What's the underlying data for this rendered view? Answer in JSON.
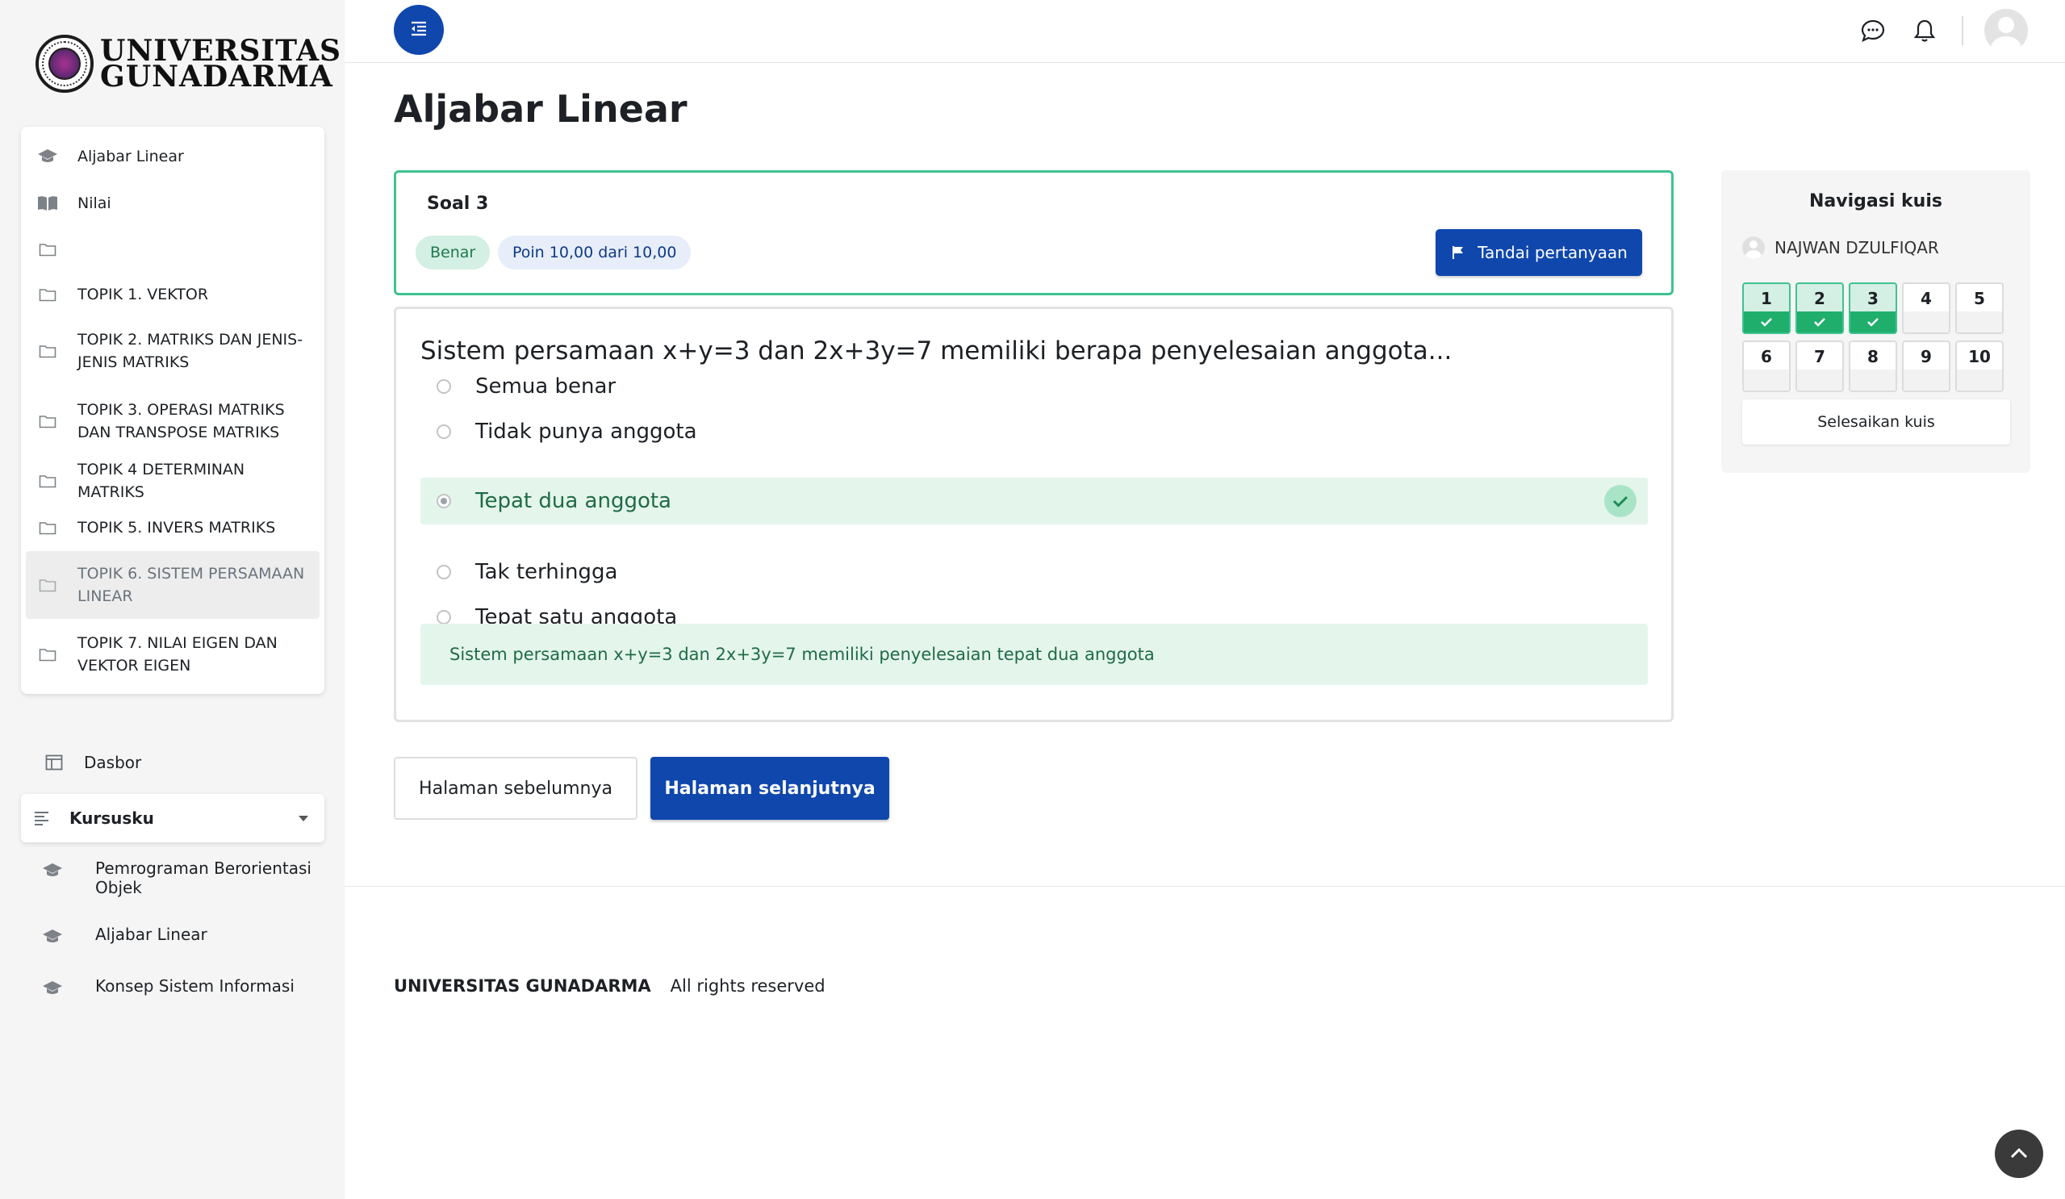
{
  "sidebar": {
    "logo": {
      "line1": "UNIVERSITAS",
      "line2": "GUNADARMA"
    },
    "course_index": [
      {
        "label": "Aljabar Linear",
        "icon": "graduation-cap-icon"
      },
      {
        "label": "Nilai",
        "icon": "book-icon"
      },
      {
        "label": "",
        "icon": "folder-icon"
      },
      {
        "label": "TOPIK 1. VEKTOR",
        "icon": "folder-icon"
      },
      {
        "label": "TOPIK 2. MATRIKS DAN JENIS-JENIS MATRIKS",
        "icon": "folder-icon"
      },
      {
        "label": "TOPIK 3. OPERASI MATRIKS DAN TRANSPOSE MATRIKS",
        "icon": "folder-icon"
      },
      {
        "label": "TOPIK 4 DETERMINAN MATRIKS",
        "icon": "folder-icon"
      },
      {
        "label": "TOPIK 5. INVERS MATRIKS",
        "icon": "folder-icon"
      },
      {
        "label": "TOPIK 6. SISTEM PERSAMAAN LINEAR",
        "icon": "folder-icon",
        "active": true
      },
      {
        "label": "TOPIK 7. NILAI EIGEN DAN VEKTOR EIGEN",
        "icon": "folder-icon"
      }
    ],
    "dashboard_label": "Dasbor",
    "my_courses_label": "Kursusku",
    "my_courses": [
      {
        "label": "Pemrograman Berorientasi Objek"
      },
      {
        "label": "Aljabar Linear"
      },
      {
        "label": "Konsep Sistem Informasi"
      }
    ]
  },
  "page": {
    "title": "Aljabar Linear"
  },
  "question": {
    "number_label": "Soal 3",
    "status": "Benar",
    "points": "Poin 10,00 dari 10,00",
    "flag_label": "Tandai pertanyaan",
    "text": "Sistem persamaan x+y=3 dan 2x+3y=7 memiliki berapa penyelesaian anggota...",
    "answers": [
      {
        "label": "Semua benar"
      },
      {
        "label": "Tidak punya anggota"
      },
      {
        "label": "Tepat dua anggota"
      },
      {
        "label": "Tak terhingga"
      },
      {
        "label": "Tepat satu anggota"
      }
    ],
    "feedback": "Sistem persamaan x+y=3 dan 2x+3y=7 memiliki penyelesaian tepat dua anggota"
  },
  "navigation": {
    "prev_label": "Halaman sebelumnya",
    "next_label": "Halaman selanjutnya"
  },
  "quiz_nav": {
    "title": "Navigasi kuis",
    "user": "NAJWAN DZULFIQAR",
    "cells": [
      "1",
      "2",
      "3",
      "4",
      "5",
      "6",
      "7",
      "8",
      "9",
      "10"
    ],
    "finish_label": "Selesaikan kuis"
  },
  "footer": {
    "brand": "UNIVERSITAS GUNADARMA",
    "rights": "All rights reserved"
  },
  "colors": {
    "primary": "#0f47ad",
    "success": "#3fc28f",
    "success_bg": "#e4f5ec"
  }
}
